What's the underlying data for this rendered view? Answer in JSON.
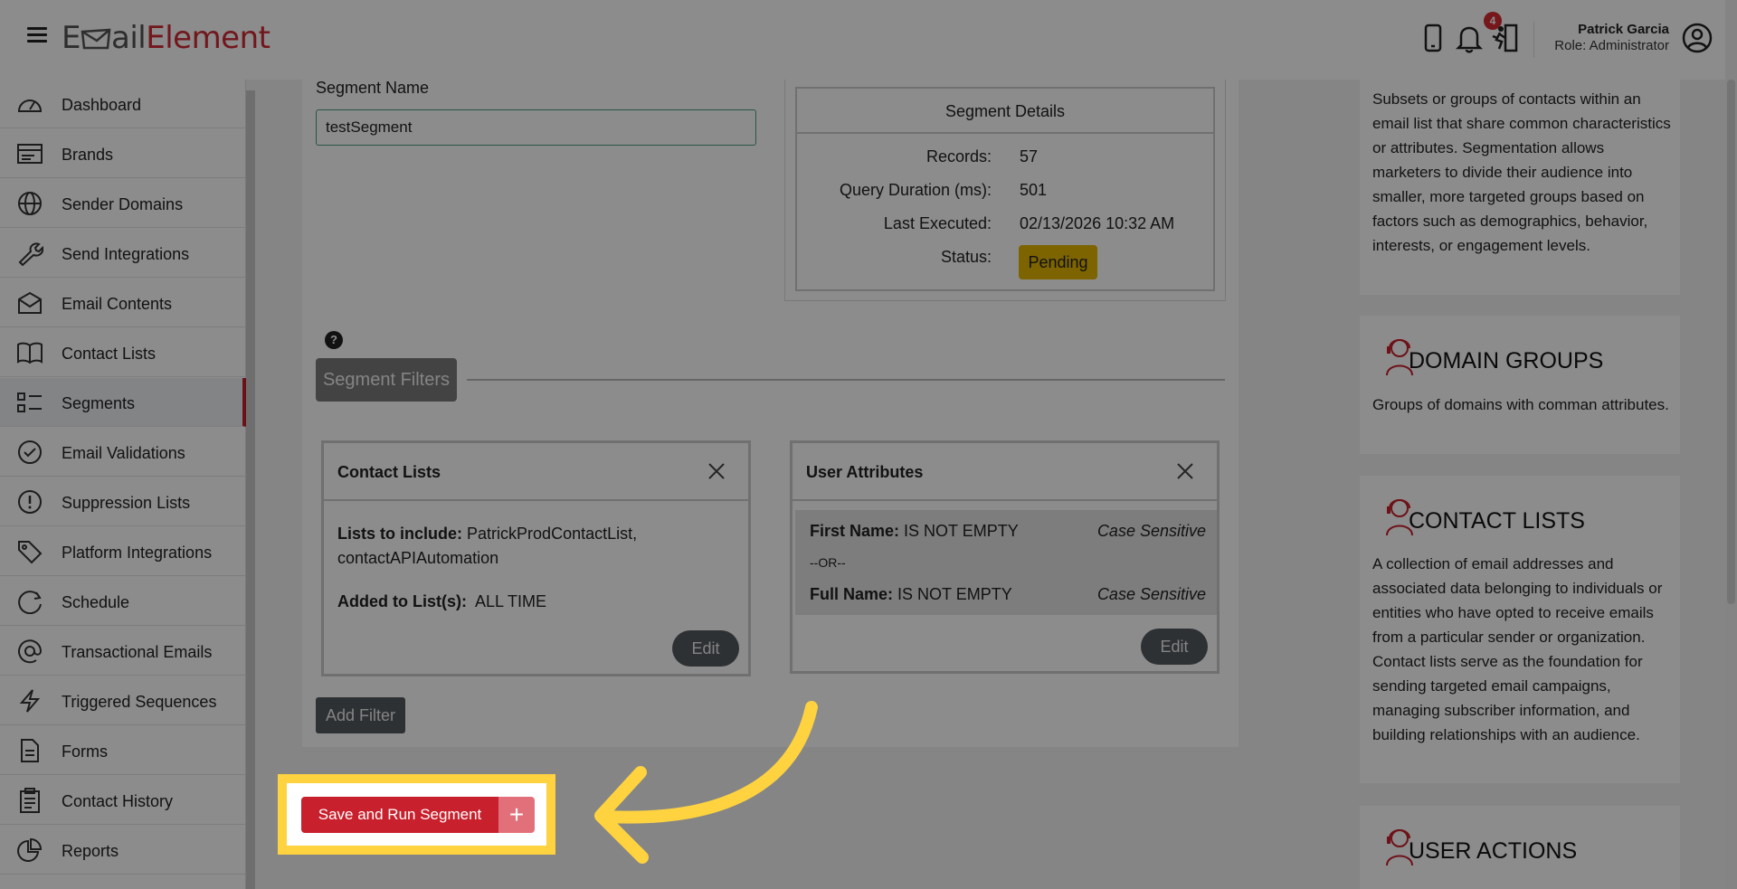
{
  "header": {
    "logo_part1": "E",
    "logo_part2": "ail",
    "logo_part3": "Element",
    "notification_count": "4",
    "user_name": "Patrick Garcia",
    "user_role": "Role: Administrator"
  },
  "sidebar": {
    "items": [
      {
        "label": "Dashboard",
        "icon": "dashboard-icon"
      },
      {
        "label": "Brands",
        "icon": "brands-icon"
      },
      {
        "label": "Sender Domains",
        "icon": "globe-icon"
      },
      {
        "label": "Send Integrations",
        "icon": "wrench-icon"
      },
      {
        "label": "Email Contents",
        "icon": "envelope-icon"
      },
      {
        "label": "Contact Lists",
        "icon": "book-icon"
      },
      {
        "label": "Segments",
        "icon": "list-icon"
      },
      {
        "label": "Email Validations",
        "icon": "check-circle-icon"
      },
      {
        "label": "Suppression Lists",
        "icon": "alert-circle-icon"
      },
      {
        "label": "Platform Integrations",
        "icon": "tag-icon"
      },
      {
        "label": "Schedule",
        "icon": "schedule-icon"
      },
      {
        "label": "Transactional Emails",
        "icon": "at-icon"
      },
      {
        "label": "Triggered Sequences",
        "icon": "lightning-icon"
      },
      {
        "label": "Forms",
        "icon": "document-icon"
      },
      {
        "label": "Contact History",
        "icon": "clipboard-icon"
      },
      {
        "label": "Reports",
        "icon": "pie-chart-icon"
      }
    ],
    "active_index": 6
  },
  "segment": {
    "name_label": "Segment Name",
    "name_value": "testSegment",
    "details": {
      "title": "Segment Details",
      "records_label": "Records:",
      "records_value": "57",
      "duration_label": "Query Duration (ms):",
      "duration_value": "501",
      "executed_label": "Last Executed:",
      "executed_value": "02/13/2026 10:32 AM",
      "status_label": "Status:",
      "status_value": "Pending"
    },
    "help_symbol": "?",
    "filters_label": "Segment Filters",
    "contact_lists_card": {
      "title": "Contact Lists",
      "include_label": "Lists to include:",
      "include_value": "PatrickProdContactList,",
      "include_value_2": "contactAPIAutomation",
      "added_label": "Added to List(s):",
      "added_value": "ALL TIME",
      "edit_label": "Edit"
    },
    "user_attributes_card": {
      "title": "User Attributes",
      "attr1_label": "First Name:",
      "attr1_value": "IS NOT EMPTY",
      "attr1_case": "Case Sensitive",
      "or_label": "--OR--",
      "attr2_label": "Full Name:",
      "attr2_value": "IS NOT EMPTY",
      "attr2_case": "Case Sensitive",
      "edit_label": "Edit"
    },
    "add_filter_label": "Add Filter",
    "save_run_label": "Save and Run Segment",
    "plus_label": "+"
  },
  "right_panels": {
    "segments_text": "Subsets or groups of contacts within an email list that share common characteristics or attributes. Segmentation allows marketers to divide their audience into smaller, more targeted groups based on factors such as demographics, behavior, interests, or engagement levels.",
    "domain_groups_title": "DOMAIN GROUPS",
    "domain_groups_text": "Groups of domains with comman attributes.",
    "contact_lists_title": "CONTACT LISTS",
    "contact_lists_text": "A collection of email addresses and associated data belonging to individuals or entities who have opted to receive emails from a particular sender or organization. Contact lists serve as the foundation for sending targeted email campaigns, managing subscriber information, and building relationships with an audience.",
    "user_actions_title": "USER ACTIONS"
  },
  "colors": {
    "brand_red": "#c8202c",
    "highlight_yellow": "#ffd33f",
    "status_pending": "#e3b600"
  }
}
